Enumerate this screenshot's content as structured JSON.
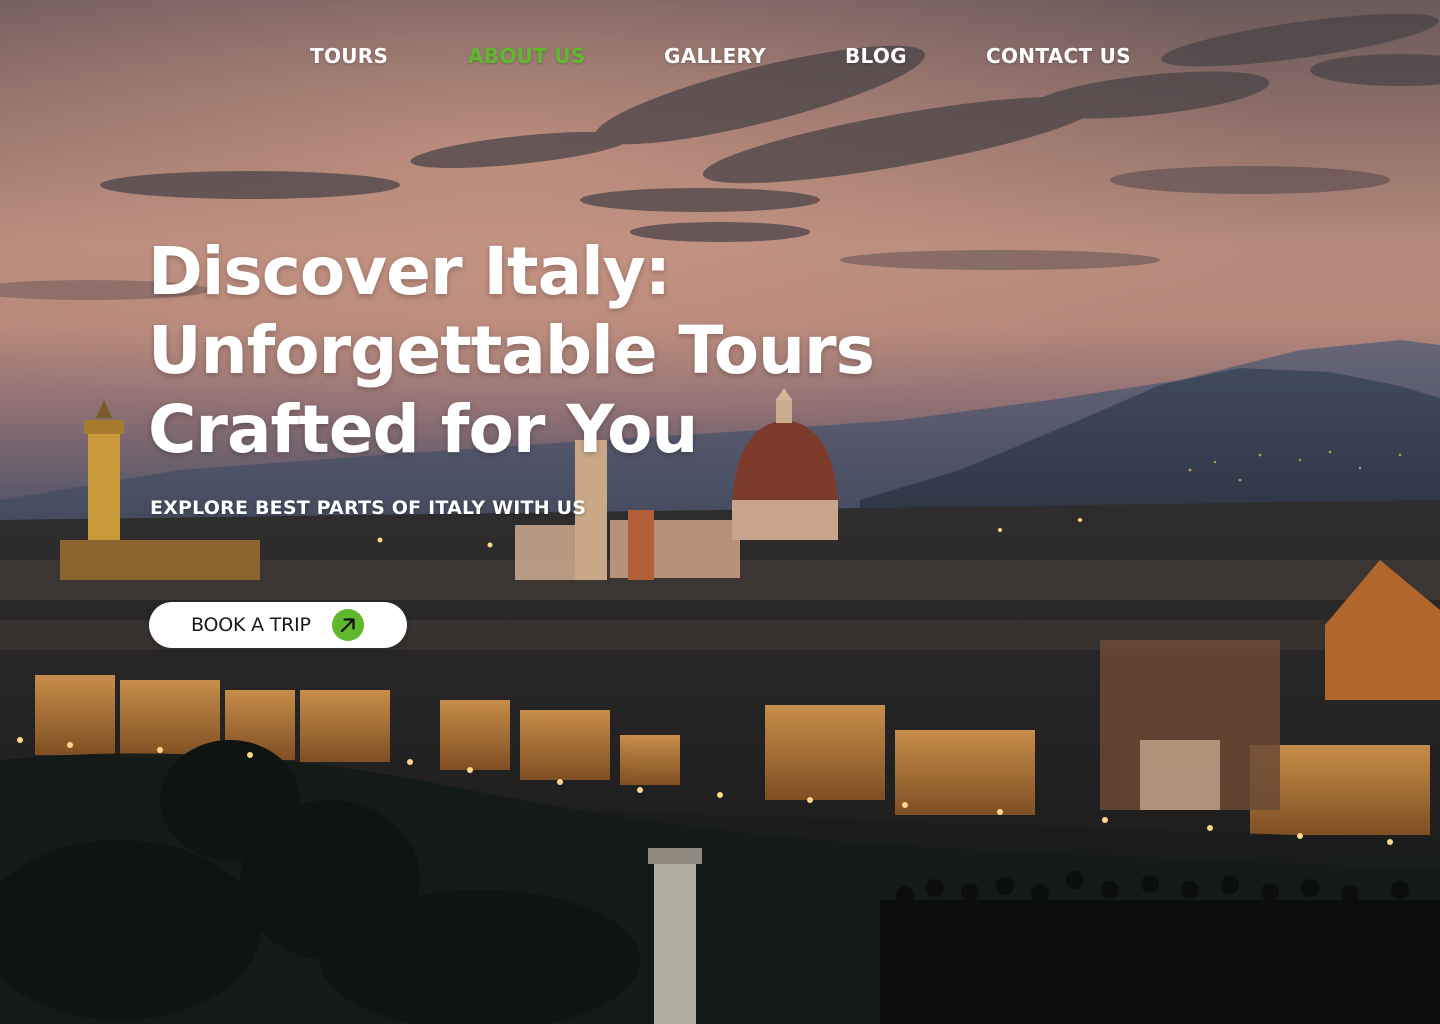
{
  "nav": {
    "items": [
      {
        "label": "TOURS",
        "active": false
      },
      {
        "label": "ABOUT US",
        "active": true
      },
      {
        "label": "GALLERY",
        "active": false
      },
      {
        "label": "BLOG",
        "active": false
      },
      {
        "label": "CONTACT US",
        "active": false
      }
    ]
  },
  "hero": {
    "title_lines": [
      "Discover Italy:",
      "Unforgettable Tours",
      "Crafted for You"
    ],
    "subtitle": "EXPLORE BEST PARTS OF ITALY WITH US",
    "cta_label": "BOOK A TRIP",
    "cta_icon": "arrow-up-right-icon"
  },
  "colors": {
    "accent": "#5fb82e",
    "text": "#ffffff",
    "button_bg": "#ffffff",
    "button_text": "#1a1a1a"
  }
}
